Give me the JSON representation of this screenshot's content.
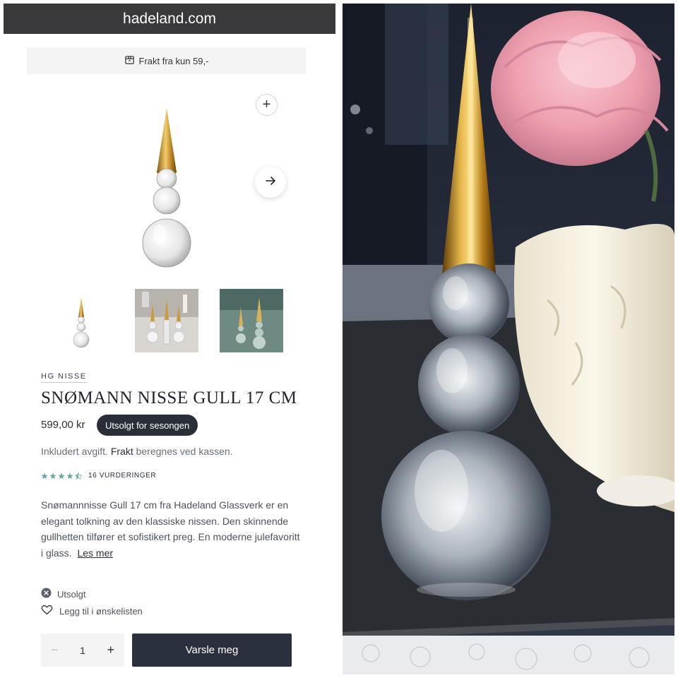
{
  "browser": {
    "url": "hadeland.com"
  },
  "promo": {
    "text": "Frakt fra kun 59,-",
    "icon": "box-icon"
  },
  "gallery": {
    "zoom_icon": "plus-icon",
    "next_icon": "arrow-right-icon",
    "thumbnails": [
      "product-thumbnail",
      "lifestyle-thumbnail",
      "dark-lifestyle-thumbnail"
    ]
  },
  "product": {
    "brand": "HG NISSE",
    "title": "SNØMANN NISSE GULL 17 CM",
    "price": "599,00 kr",
    "badge": "Utsolgt for sesongen",
    "tax_prefix": "Inkludert avgift.",
    "tax_link": "Frakt",
    "tax_suffix": "beregnes ved kassen.",
    "rating": {
      "value": 4.5,
      "max": 5,
      "count_label": "16 VURDERINGER"
    },
    "description": "Snømannnisse Gull 17 cm fra Hadeland Glassverk er en elegant tolkning av den klassiske nissen. Den skinnende gullhetten tilfører et sofistikert preg. En moderne julefavoritt i glass.",
    "read_more": "Les mer",
    "stock_status": "Utsolgt",
    "wishlist": "Legg til i ønskelisten",
    "quantity": "1",
    "qty_minus": "−",
    "qty_plus": "+",
    "notify_button": "Varsle meg"
  },
  "colors": {
    "dark_button": "#2a303d",
    "star": "#6fa9a3",
    "gold": "#c79a3a"
  }
}
